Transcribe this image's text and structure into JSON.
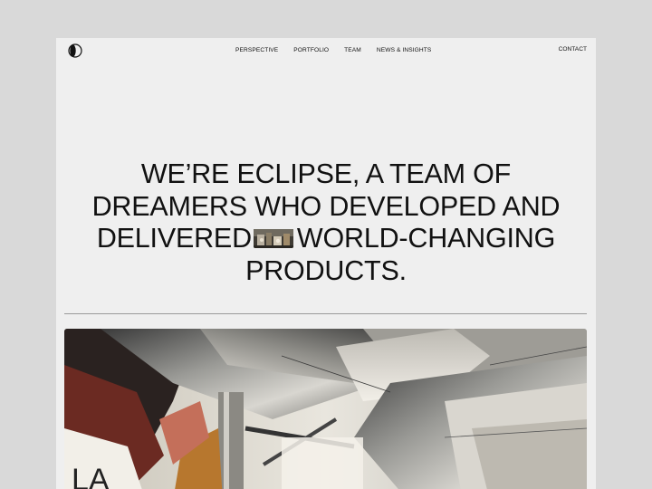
{
  "nav": {
    "items": [
      "PERSPECTIVE",
      "PORTFOLIO",
      "TEAM",
      "NEWS & INSIGHTS"
    ],
    "contact": "CONTACT"
  },
  "hero": {
    "line1": "WE’RE ECLIPSE, A TEAM OF",
    "line2": "DREAMERS WHO DEVELOPED AND",
    "line3a": "DELIVERED",
    "line3b": "WORLD-CHANGING",
    "line4": "PRODUCTS."
  },
  "icons": {
    "logo": "eclipse-logo-icon"
  },
  "colors": {
    "background": "#efefef",
    "outer": "#d9d9d9",
    "text": "#111111",
    "divider": "#9a9a9a"
  }
}
